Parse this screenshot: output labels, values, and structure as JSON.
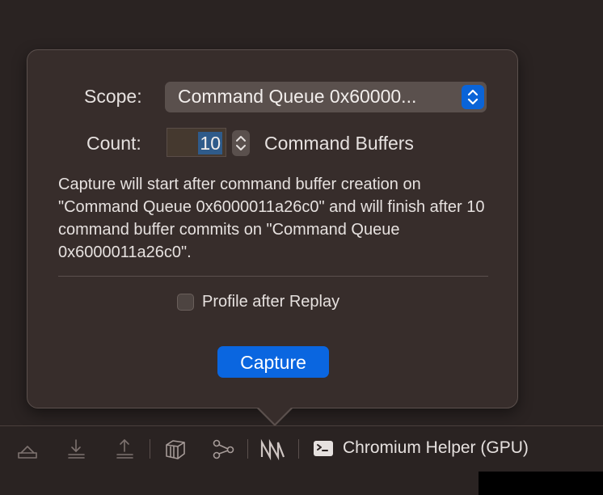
{
  "popover": {
    "scope_label": "Scope:",
    "scope_value": "Command Queue 0x60000...",
    "count_label": "Count:",
    "count_value": "10",
    "count_unit": "Command Buffers",
    "description": "Capture will start after command buffer creation on \"Command Queue 0x6000011a26c0\" and will finish after 10 command buffer commits on \"Command Queue 0x6000011a26c0\".",
    "profile_label": "Profile after Replay",
    "profile_checked": false,
    "capture_button": "Capture"
  },
  "toolbar": {
    "icons": [
      "tray-up-icon",
      "download-icon",
      "upload-icon",
      "layers-icon",
      "graph-icon",
      "metal-icon",
      "terminal-icon"
    ],
    "process_label": "Chromium Helper (GPU)"
  },
  "colors": {
    "accent": "#0a66e0",
    "panel": "#372d2b",
    "background": "#2a2322"
  }
}
